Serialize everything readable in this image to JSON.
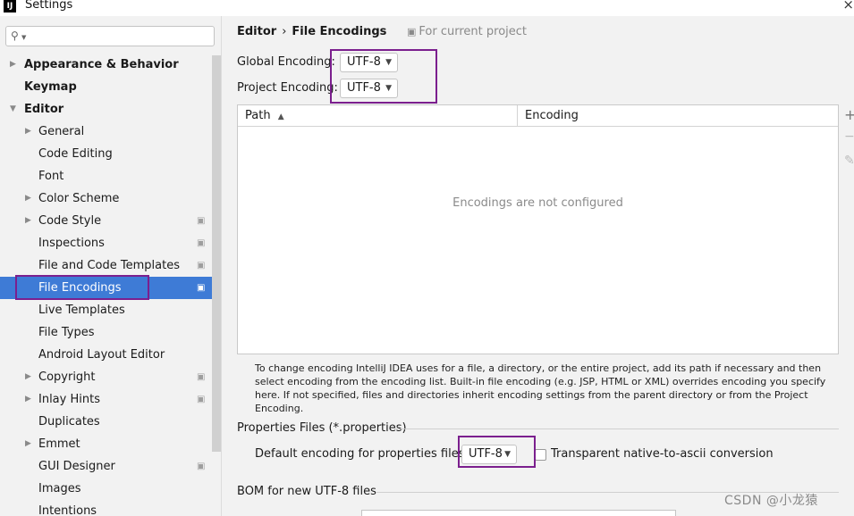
{
  "window": {
    "title": "Settings",
    "app_icon": "IJ",
    "close_glyph": "×"
  },
  "search": {
    "value": "",
    "icon": "search-icon"
  },
  "tree": [
    {
      "label": "Appearance & Behavior",
      "level": 0,
      "expandable": true,
      "expanded": false,
      "project": false
    },
    {
      "label": "Keymap",
      "level": 0,
      "expandable": false,
      "expanded": false,
      "project": false
    },
    {
      "label": "Editor",
      "level": 0,
      "expandable": true,
      "expanded": true,
      "project": false
    },
    {
      "label": "General",
      "level": 1,
      "expandable": true,
      "expanded": false,
      "project": false
    },
    {
      "label": "Code Editing",
      "level": 1,
      "expandable": false,
      "expanded": false,
      "project": false
    },
    {
      "label": "Font",
      "level": 1,
      "expandable": false,
      "expanded": false,
      "project": false
    },
    {
      "label": "Color Scheme",
      "level": 1,
      "expandable": true,
      "expanded": false,
      "project": false
    },
    {
      "label": "Code Style",
      "level": 1,
      "expandable": true,
      "expanded": false,
      "project": true
    },
    {
      "label": "Inspections",
      "level": 1,
      "expandable": false,
      "expanded": false,
      "project": true
    },
    {
      "label": "File and Code Templates",
      "level": 1,
      "expandable": false,
      "expanded": false,
      "project": true
    },
    {
      "label": "File Encodings",
      "level": 1,
      "expandable": false,
      "expanded": false,
      "project": true,
      "selected": true
    },
    {
      "label": "Live Templates",
      "level": 1,
      "expandable": false,
      "expanded": false,
      "project": false
    },
    {
      "label": "File Types",
      "level": 1,
      "expandable": false,
      "expanded": false,
      "project": false
    },
    {
      "label": "Android Layout Editor",
      "level": 1,
      "expandable": false,
      "expanded": false,
      "project": false
    },
    {
      "label": "Copyright",
      "level": 1,
      "expandable": true,
      "expanded": false,
      "project": true
    },
    {
      "label": "Inlay Hints",
      "level": 1,
      "expandable": true,
      "expanded": false,
      "project": true
    },
    {
      "label": "Duplicates",
      "level": 1,
      "expandable": false,
      "expanded": false,
      "project": false
    },
    {
      "label": "Emmet",
      "level": 1,
      "expandable": true,
      "expanded": false,
      "project": false
    },
    {
      "label": "GUI Designer",
      "level": 1,
      "expandable": false,
      "expanded": false,
      "project": true
    },
    {
      "label": "Images",
      "level": 1,
      "expandable": false,
      "expanded": false,
      "project": false
    },
    {
      "label": "Intentions",
      "level": 1,
      "expandable": false,
      "expanded": false,
      "project": false
    }
  ],
  "main": {
    "breadcrumb": {
      "parent": "Editor",
      "separator": "›",
      "current": "File Encodings"
    },
    "scope_note": "For current project",
    "global_encoding": {
      "label": "Global Encoding:",
      "value": "UTF-8"
    },
    "project_encoding": {
      "label": "Project Encoding:",
      "value": "UTF-8"
    },
    "table": {
      "columns": [
        {
          "label": "Path",
          "sort": "ascending"
        },
        {
          "label": "Encoding"
        }
      ],
      "sort_glyph": "▲",
      "empty_text": "Encodings are not configured"
    },
    "toolbar": {
      "add": "+",
      "remove": "−",
      "edit": "✎"
    },
    "hint": "To change encoding IntelliJ IDEA uses for a file, a directory, or the entire project, add its path if necessary and then select encoding from the encoding list. Built-in file encoding (e.g. JSP, HTML or XML) overrides encoding you specify here. If not specified, files and directories inherit encoding settings from the parent directory or from the Project Encoding.",
    "properties": {
      "section_title": "Properties Files (*.properties)",
      "default_label": "Default encoding for properties files:",
      "default_value": "UTF-8",
      "transparent_label": "Transparent native-to-ascii conversion",
      "transparent_checked": false
    },
    "bom": {
      "section_title": "BOM for new UTF-8 files"
    }
  },
  "watermark": "CSDN @小龙猿",
  "colors": {
    "selection": "#3e7bd6",
    "annotation": "#7b1f8e"
  }
}
